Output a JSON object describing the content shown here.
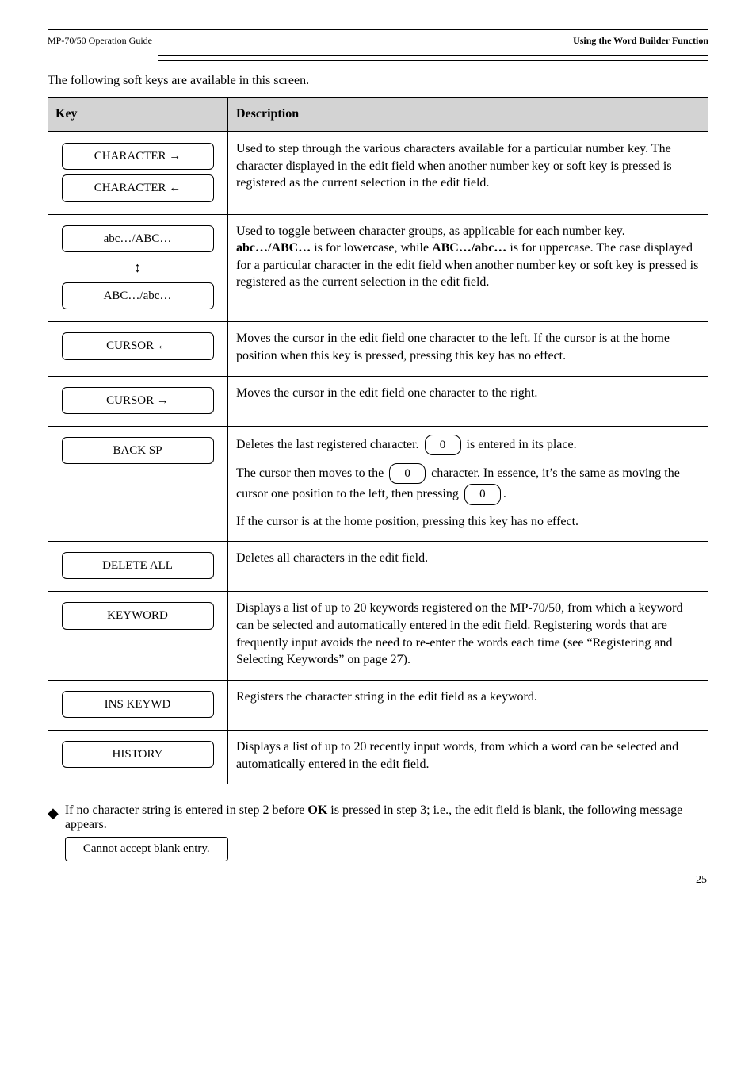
{
  "header": {
    "left": "MP-70/50 Operation Guide",
    "right": "Using the Word Builder Function"
  },
  "intro": "The following soft keys are available in this screen.",
  "table": {
    "head_key": "Key",
    "head_desc": "Description",
    "rows": [
      {
        "keys": [
          "CHARACTER →",
          "CHARACTER ←"
        ],
        "swivel": false,
        "desc": [
          "Used to step through the various characters available for a particular number key. The character displayed in the edit field when another number key or soft key is pressed is registered as the current selection in the edit field."
        ]
      },
      {
        "keys": [
          "abc…/ABC…",
          "ABC…/abc…"
        ],
        "swivel": true,
        "desc_html": "Used to toggle between character groups, as applicable for each number key. <span class=\"bold\">abc…/ABC…</span> is for lowercase, while <span class=\"bold\">ABC…/abc…</span> is for uppercase. The case displayed for a particular character in the edit field when another number key or soft key is pressed is registered as the current selection in the edit field."
      },
      {
        "keys": [
          "CURSOR ←"
        ],
        "swivel": false,
        "desc": [
          "Moves the cursor in the edit field one character to the left. If the cursor is at the home position when this key is pressed, pressing this key has no effect."
        ]
      },
      {
        "keys": [
          "CURSOR →"
        ],
        "swivel": false,
        "desc": [
          "Moves the cursor in the edit field one character to the right."
        ]
      },
      {
        "keys": [
          "BACK SP"
        ],
        "swivel": false,
        "desc_complex": true
      },
      {
        "keys": [
          "DELETE ALL"
        ],
        "swivel": false,
        "desc": [
          "Deletes all characters in the edit field."
        ]
      },
      {
        "keys": [
          "KEYWORD"
        ],
        "swivel": false,
        "desc": [
          "Displays a list of up to 20 keywords registered on the MP-70/50, from which a keyword can be selected and automatically entered in the edit field. Registering words that are frequently input avoids the need to re-enter the words each time (see “Registering and Selecting Keywords” on page 27)."
        ]
      },
      {
        "keys": [
          "INS KEYWD"
        ],
        "swivel": false,
        "desc": [
          "Registers the character string in the edit field as a keyword."
        ]
      },
      {
        "keys": [
          "HISTORY"
        ],
        "swivel": false,
        "desc": [
          "Displays a list of up to 20 recently input words, from which a word can be selected and automatically entered in the edit field."
        ]
      }
    ],
    "backsp": {
      "line1_pre": "Deletes the last registered character. ",
      "line1_key": "0",
      "line1_post": " is entered in its place.",
      "line2_pre": "The cursor then moves to the ",
      "line2_key": "0",
      "line2_post": " character. In essence, it’s the same as moving the cursor one position to the left, then pressing ",
      "line2_key2": "0",
      "line2_post2": ".",
      "line3": "If the cursor is at the home position, pressing this key has no effect."
    }
  },
  "footnote": {
    "text_pre": "If no character string is entered in step 2 before ",
    "ok": "OK",
    "text_post": " is pressed in step 3; i.e., the edit field is blank, the following message appears.",
    "msg": "Cannot accept blank entry."
  },
  "page": "25"
}
